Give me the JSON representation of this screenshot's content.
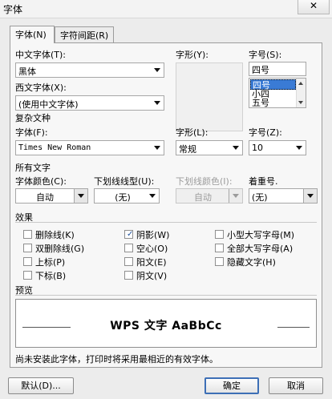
{
  "window": {
    "title": "字体",
    "close_label": "✕"
  },
  "tabs": [
    {
      "label": "字体(N)",
      "active": true
    },
    {
      "label": "字符间距(R)",
      "active": false
    }
  ],
  "font": {
    "chinese_font_label": "中文字体(T):",
    "chinese_font_value": "黑体",
    "style_label": "字形(Y):",
    "size_label": "字号(S):",
    "size_value": "四号",
    "size_options": [
      "四号",
      "小四",
      "五号"
    ],
    "western_font_label": "西文字体(X):",
    "western_font_value": "(使用中文字体)"
  },
  "complex": {
    "header": "复杂文种",
    "font_label": "字体(F):",
    "font_value": "Times New Roman",
    "style_label": "字形(L):",
    "style_value": "常规",
    "size_label": "字号(Z):",
    "size_value": "10"
  },
  "all_text": {
    "header": "所有文字",
    "color_label": "字体颜色(C):",
    "color_value": "自动",
    "underline_label": "下划线线型(U):",
    "underline_value": "(无)",
    "underline_color_label": "下划线颜色(I):",
    "underline_color_value": "自动",
    "emphasis_label": "着重号.",
    "emphasis_value": "(无)"
  },
  "effects": {
    "header": "效果",
    "items": [
      {
        "label": "删除线(K)",
        "checked": false
      },
      {
        "label": "双删除线(G)",
        "checked": false
      },
      {
        "label": "上标(P)",
        "checked": false
      },
      {
        "label": "下标(B)",
        "checked": false
      },
      {
        "label": "阴影(W)",
        "checked": true
      },
      {
        "label": "空心(O)",
        "checked": false
      },
      {
        "label": "阳文(E)",
        "checked": false
      },
      {
        "label": "阴文(V)",
        "checked": false
      },
      {
        "label": "小型大写字母(M)",
        "checked": false
      },
      {
        "label": "全部大写字母(A)",
        "checked": false
      },
      {
        "label": "隐藏文字(H)",
        "checked": false
      }
    ]
  },
  "preview": {
    "header": "预览",
    "sample_text": "WPS 文字 AaBbCc"
  },
  "hint": "尚未安装此字体，打印时将采用最相近的有效字体。",
  "buttons": {
    "default_label": "默认(D)...",
    "ok_label": "确定",
    "cancel_label": "取消"
  }
}
